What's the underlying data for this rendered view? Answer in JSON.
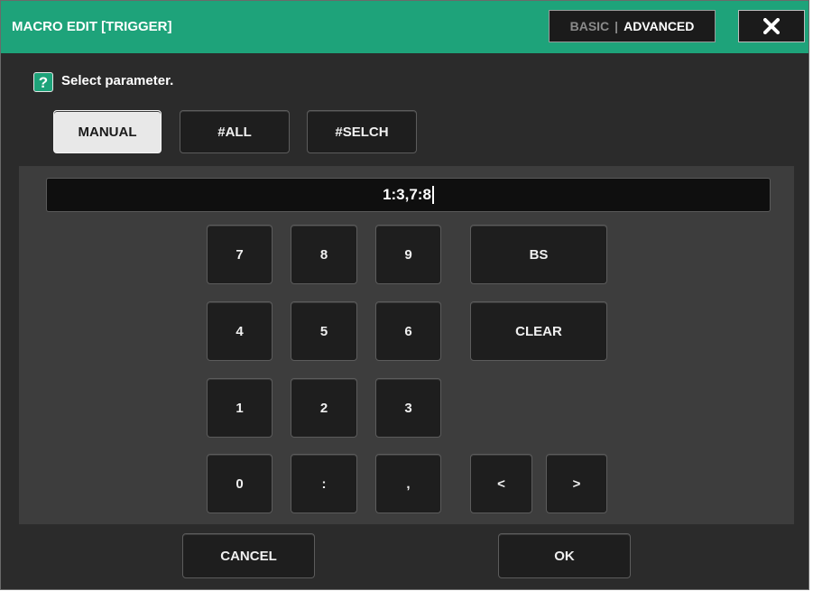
{
  "window": {
    "title": "MACRO EDIT [TRIGGER]",
    "mode_basic": "BASIC",
    "mode_separator": "|",
    "mode_advanced": "ADVANCED",
    "close_icon": "close-icon"
  },
  "prompt": {
    "help_icon": "?",
    "text": "Select parameter."
  },
  "modes": {
    "manual": "MANUAL",
    "all": "#ALL",
    "selch": "#SELCH",
    "selected": "MANUAL"
  },
  "entry": {
    "value": "1:3,7:8"
  },
  "keypad": {
    "k7": "7",
    "k8": "8",
    "k9": "9",
    "k4": "4",
    "k5": "5",
    "k6": "6",
    "k1": "1",
    "k2": "2",
    "k3": "3",
    "k0": "0",
    "colon": ":",
    "comma": ",",
    "bs": "BS",
    "clear": "CLEAR",
    "left": "<",
    "right": ">"
  },
  "footer": {
    "cancel": "CANCEL",
    "ok": "OK"
  }
}
